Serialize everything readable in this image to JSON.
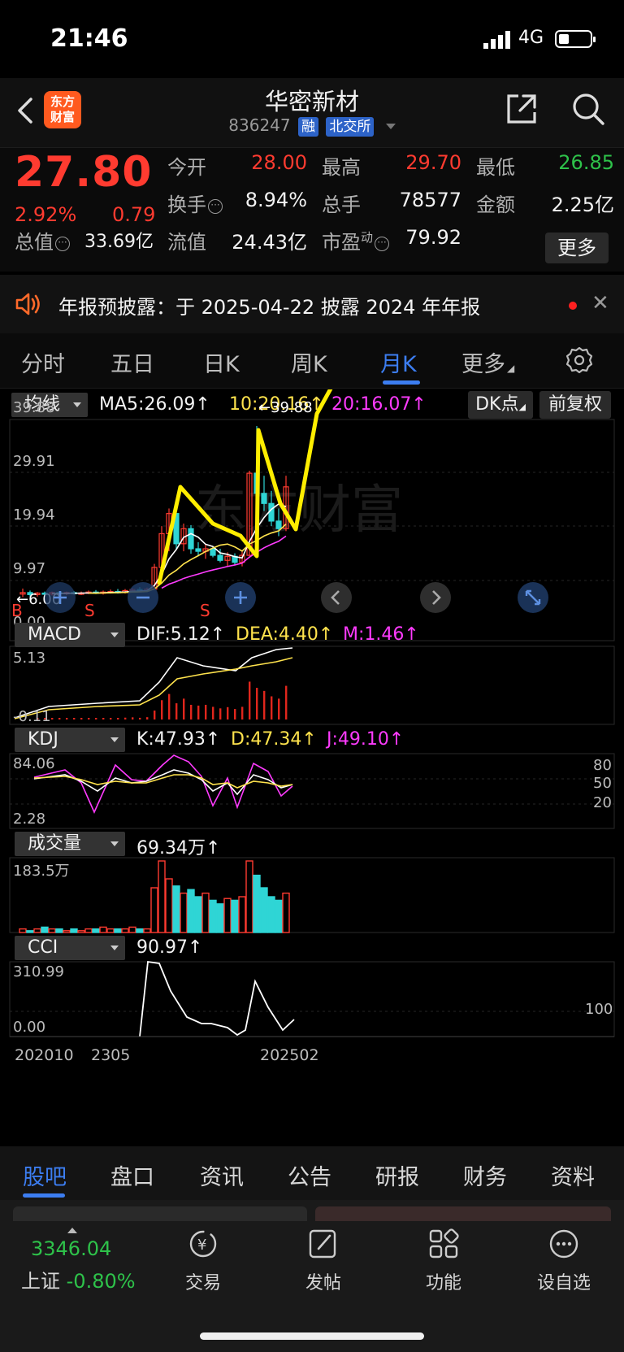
{
  "status": {
    "time": "21:46",
    "network": "4G"
  },
  "header": {
    "logo_line1": "东方",
    "logo_line2": "财富",
    "title": "华密新材",
    "code": "836247",
    "tag1": "融",
    "tag2": "北交所"
  },
  "quote": {
    "price": "27.80",
    "change_pct": "2.92%",
    "change_val": "0.79",
    "open_label": "今开",
    "open": "28.00",
    "high_label": "最高",
    "high": "29.70",
    "low_label": "最低",
    "low": "26.85",
    "turnover_label": "换手",
    "turnover": "8.94%",
    "volume_label": "总手",
    "volume": "78577",
    "amount_label": "金额",
    "amount": "2.25亿",
    "mcap_label": "总值",
    "mcap": "33.69亿",
    "float_label": "流值",
    "float": "24.43亿",
    "pe_label": "市盈",
    "pe_sup": "动",
    "pe": "79.92",
    "more": "更多"
  },
  "notice": {
    "text": "年报预披露：于 2025-04-22 披露 2024 年年报"
  },
  "period_tabs": [
    "分时",
    "五日",
    "日K",
    "周K",
    "月K",
    "更多"
  ],
  "active_period": "月K",
  "main_chart": {
    "selector": "均线",
    "ma5": "MA5:26.09↑",
    "ma10": "10:20.16↑",
    "ma20": "20:16.07↑",
    "dk_btn": "DK点",
    "adj_btn": "前复权",
    "y_labels": [
      "39.88",
      "29.91",
      "19.94",
      "9.97",
      "0.00"
    ],
    "max_marker": "←39.88",
    "min_marker": "←6.00",
    "watermark": "东方财富",
    "s_marks": [
      "S",
      "S",
      "S"
    ],
    "b_mark": "B"
  },
  "macd": {
    "selector": "MACD",
    "dif": "DIF:5.12↑",
    "dea": "DEA:4.40↑",
    "m": "M:1.46↑",
    "top": "5.13",
    "bottom": "-0.11"
  },
  "kdj": {
    "selector": "KDJ",
    "k": "K:47.93↑",
    "d": "D:47.34↑",
    "j": "J:49.10↑",
    "top": "84.06",
    "bottom": "2.28",
    "levels": [
      "80",
      "50",
      "20"
    ]
  },
  "volume": {
    "selector": "成交量",
    "value": "69.34万↑",
    "top": "183.5万"
  },
  "cci": {
    "selector": "CCI",
    "value": "90.97↑",
    "top": "310.99",
    "bottom": "0.00",
    "level": "100"
  },
  "x_axis": {
    "start": "202010",
    "mid": "2305",
    "end": "202502"
  },
  "bottom_tabs": [
    "股吧",
    "盘口",
    "资讯",
    "公告",
    "研报",
    "财务",
    "资料"
  ],
  "active_bottom_tab": "股吧",
  "toolbar": {
    "index_value": "3346.04",
    "index_name": "上证",
    "index_change": "-0.80%",
    "trade": "交易",
    "post": "发帖",
    "functions": "功能",
    "watchlist": "设自选"
  },
  "chart_data": {
    "type": "candlestick",
    "title": "",
    "period": "monthly",
    "ylim": [
      0,
      39.88
    ],
    "candles": [
      {
        "o": 6.5,
        "h": 7.6,
        "l": 5.9,
        "c": 6.8,
        "up": true
      },
      {
        "o": 6.8,
        "h": 7.2,
        "l": 6.0,
        "c": 6.4,
        "up": false
      },
      {
        "o": 6.4,
        "h": 6.9,
        "l": 6.0,
        "c": 6.7,
        "up": true
      },
      {
        "o": 6.7,
        "h": 7.0,
        "l": 6.2,
        "c": 6.5,
        "up": false
      },
      {
        "o": 6.5,
        "h": 7.0,
        "l": 6.2,
        "c": 6.8,
        "up": true
      },
      {
        "o": 6.8,
        "h": 7.1,
        "l": 6.3,
        "c": 6.6,
        "up": false
      },
      {
        "o": 6.6,
        "h": 7.0,
        "l": 6.3,
        "c": 6.8,
        "up": true
      },
      {
        "o": 6.8,
        "h": 7.1,
        "l": 6.4,
        "c": 6.6,
        "up": false
      },
      {
        "o": 6.6,
        "h": 7.0,
        "l": 6.3,
        "c": 6.7,
        "up": true
      },
      {
        "o": 6.7,
        "h": 7.2,
        "l": 6.5,
        "c": 6.9,
        "up": true
      },
      {
        "o": 6.9,
        "h": 7.3,
        "l": 6.5,
        "c": 6.7,
        "up": false
      },
      {
        "o": 6.7,
        "h": 7.2,
        "l": 6.4,
        "c": 6.9,
        "up": true
      },
      {
        "o": 6.9,
        "h": 7.4,
        "l": 6.6,
        "c": 7.0,
        "up": true
      },
      {
        "o": 7.0,
        "h": 7.5,
        "l": 6.6,
        "c": 6.8,
        "up": false
      },
      {
        "o": 6.8,
        "h": 7.5,
        "l": 6.6,
        "c": 7.2,
        "up": true
      },
      {
        "o": 7.2,
        "h": 7.7,
        "l": 6.9,
        "c": 7.4,
        "up": true
      },
      {
        "o": 7.4,
        "h": 7.9,
        "l": 7.0,
        "c": 7.1,
        "up": false
      },
      {
        "o": 7.1,
        "h": 7.8,
        "l": 6.9,
        "c": 7.5,
        "up": true
      },
      {
        "o": 7.5,
        "h": 12.5,
        "l": 7.3,
        "c": 11.8,
        "up": true
      },
      {
        "o": 11.8,
        "h": 20.0,
        "l": 11.0,
        "c": 18.5,
        "up": true
      },
      {
        "o": 18.5,
        "h": 23.5,
        "l": 15.0,
        "c": 22.5,
        "up": true
      },
      {
        "o": 22.5,
        "h": 23.0,
        "l": 15.5,
        "c": 16.5,
        "up": false
      },
      {
        "o": 16.5,
        "h": 20.5,
        "l": 15.0,
        "c": 19.5,
        "up": true
      },
      {
        "o": 19.5,
        "h": 20.2,
        "l": 14.5,
        "c": 15.5,
        "up": false
      },
      {
        "o": 15.5,
        "h": 16.8,
        "l": 14.0,
        "c": 15.0,
        "up": false
      },
      {
        "o": 15.0,
        "h": 16.5,
        "l": 13.5,
        "c": 15.5,
        "up": true
      },
      {
        "o": 15.5,
        "h": 16.0,
        "l": 13.8,
        "c": 14.2,
        "up": false
      },
      {
        "o": 14.2,
        "h": 15.5,
        "l": 12.8,
        "c": 13.2,
        "up": false
      },
      {
        "o": 13.2,
        "h": 14.8,
        "l": 12.0,
        "c": 14.0,
        "up": true
      },
      {
        "o": 14.0,
        "h": 14.6,
        "l": 12.2,
        "c": 12.8,
        "up": false
      },
      {
        "o": 12.8,
        "h": 15.0,
        "l": 12.0,
        "c": 14.2,
        "up": true
      },
      {
        "o": 14.2,
        "h": 31.0,
        "l": 14.0,
        "c": 30.5,
        "up": true
      },
      {
        "o": 30.5,
        "h": 39.88,
        "l": 24.0,
        "c": 26.5,
        "up": false
      },
      {
        "o": 26.5,
        "h": 30.0,
        "l": 23.0,
        "c": 24.5,
        "up": false
      },
      {
        "o": 24.5,
        "h": 27.0,
        "l": 20.0,
        "c": 21.0,
        "up": false
      },
      {
        "o": 21.0,
        "h": 23.5,
        "l": 18.0,
        "c": 19.5,
        "up": false
      },
      {
        "o": 19.5,
        "h": 30.0,
        "l": 19.0,
        "c": 27.8,
        "up": true
      }
    ],
    "ma_series": [
      {
        "name": "MA5",
        "last": 26.09
      },
      {
        "name": "MA10",
        "last": 20.16
      },
      {
        "name": "MA20",
        "last": 16.07
      }
    ]
  }
}
